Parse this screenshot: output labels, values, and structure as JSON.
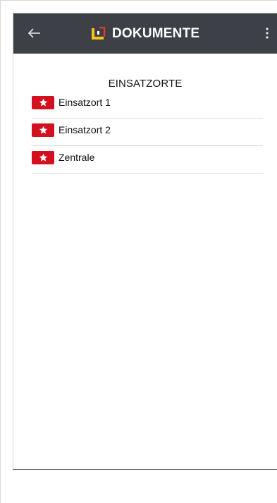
{
  "header": {
    "title": "DOKUMENTE",
    "back_icon": "arrow-left-icon",
    "menu_icon": "more-vert-icon",
    "logo_icon": "document-logo-icon",
    "background": "#3d4046"
  },
  "main": {
    "section_title": "EINSATZORTE",
    "items": [
      {
        "label": "Einsatzort 1",
        "icon": "star-badge-icon"
      },
      {
        "label": "Einsatzort 2",
        "icon": "star-badge-icon"
      },
      {
        "label": "Zentrale",
        "icon": "star-badge-icon"
      }
    ]
  },
  "colors": {
    "badge": "#d4101f",
    "logo_yellow": "#f5c518",
    "logo_red": "#e03a2a"
  }
}
